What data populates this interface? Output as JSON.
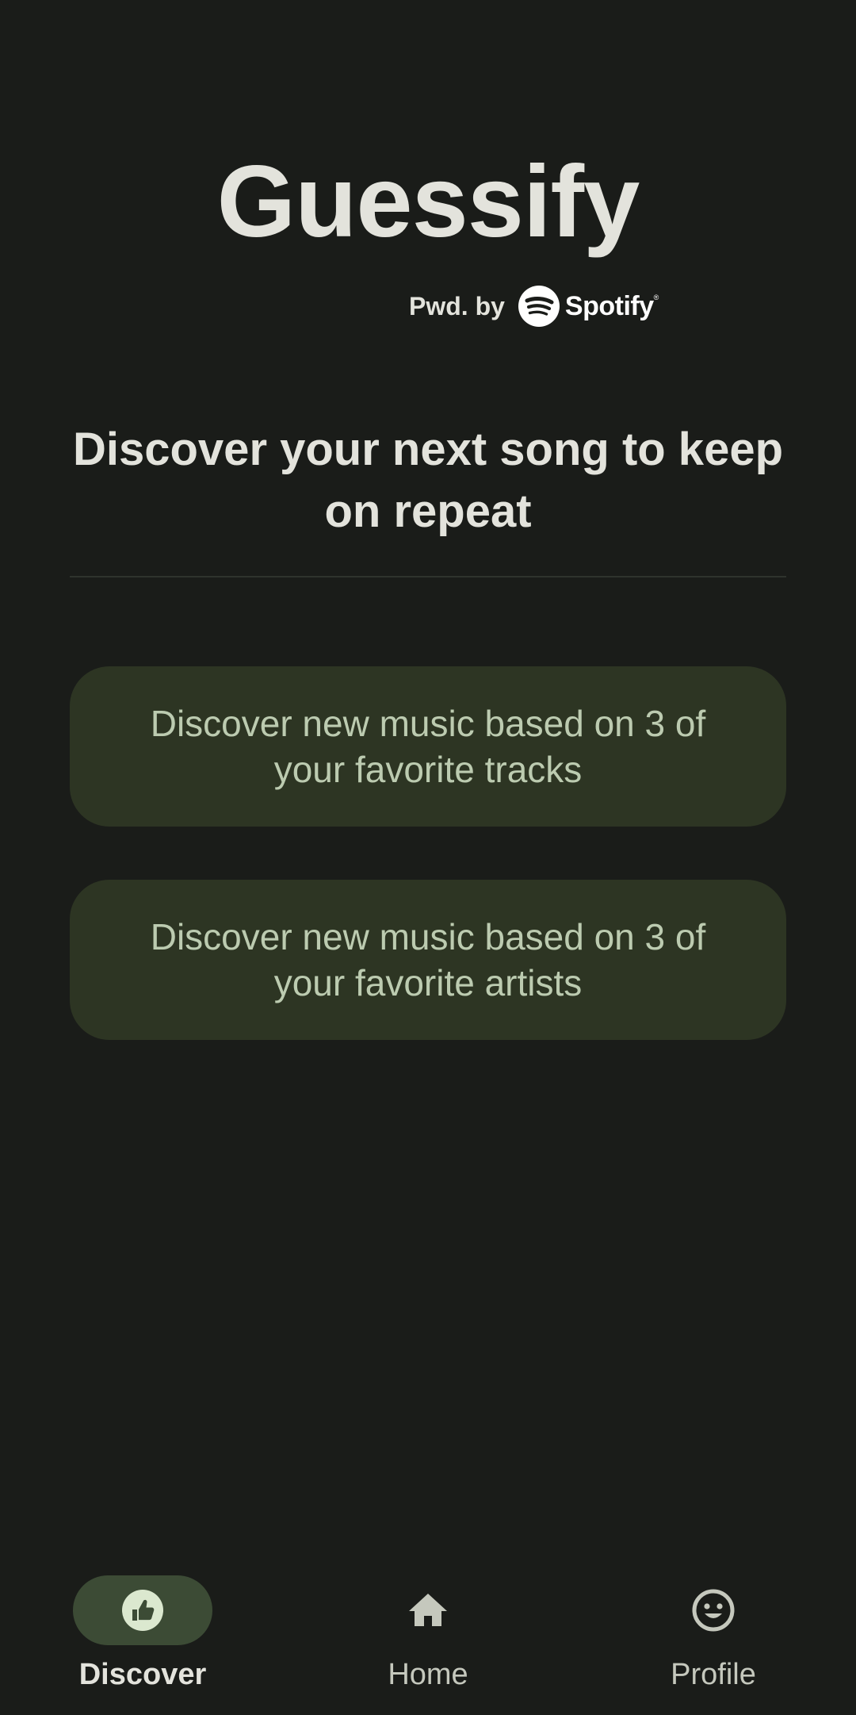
{
  "app": {
    "title": "Guessify",
    "powered_label": "Pwd. by",
    "spotify_wordmark": "Spotify"
  },
  "main": {
    "headline": "Discover your next song to keep on repeat",
    "options": [
      {
        "label": "Discover new music based on 3 of your favorite tracks"
      },
      {
        "label": "Discover new music based on 3 of your favorite artists"
      }
    ]
  },
  "bottom_nav": {
    "items": [
      {
        "label": "Discover",
        "icon": "thumb-up-icon",
        "selected": true
      },
      {
        "label": "Home",
        "icon": "home-icon",
        "selected": false
      },
      {
        "label": "Profile",
        "icon": "smiley-face-icon",
        "selected": false
      }
    ]
  },
  "colors": {
    "background": "#1a1c19",
    "button_background": "#2d3523",
    "button_text": "#bccbb0",
    "nav_active_pill": "#3c4b35",
    "text_primary": "#e3e3dc"
  }
}
